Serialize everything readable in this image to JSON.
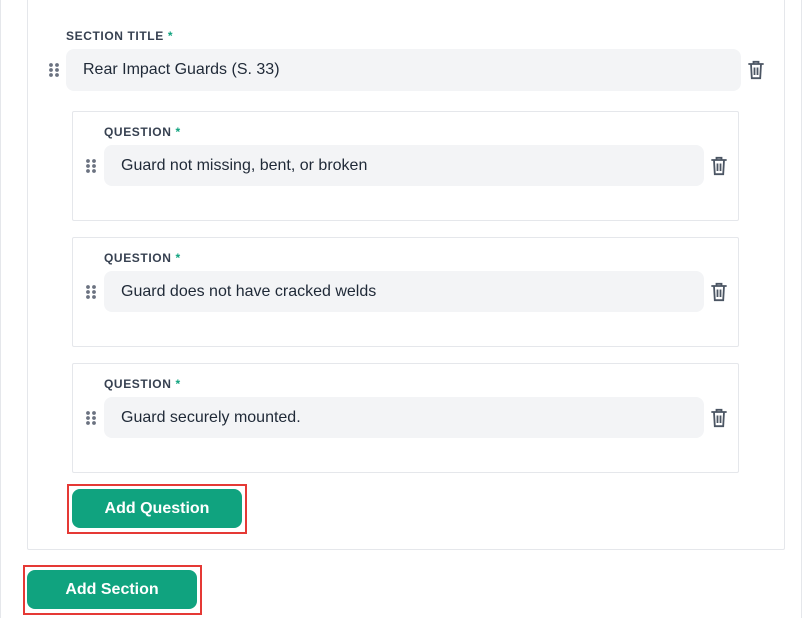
{
  "section": {
    "title_label": "SECTION TITLE",
    "required_mark": "*",
    "title_value": "Rear Impact Guards (S. 33)"
  },
  "questions": [
    {
      "label": "QUESTION",
      "required_mark": "*",
      "value": "Guard not missing, bent, or broken"
    },
    {
      "label": "QUESTION",
      "required_mark": "*",
      "value": "Guard does not have cracked welds"
    },
    {
      "label": "QUESTION",
      "required_mark": "*",
      "value": "Guard securely mounted."
    }
  ],
  "buttons": {
    "add_question": "Add Question",
    "add_section": "Add Section"
  },
  "colors": {
    "accent": "#10a37f",
    "input_bg": "#f3f4f6",
    "highlight": "#e53935"
  },
  "icons": {
    "drag": "drag-handle-icon",
    "delete": "trash-icon"
  }
}
